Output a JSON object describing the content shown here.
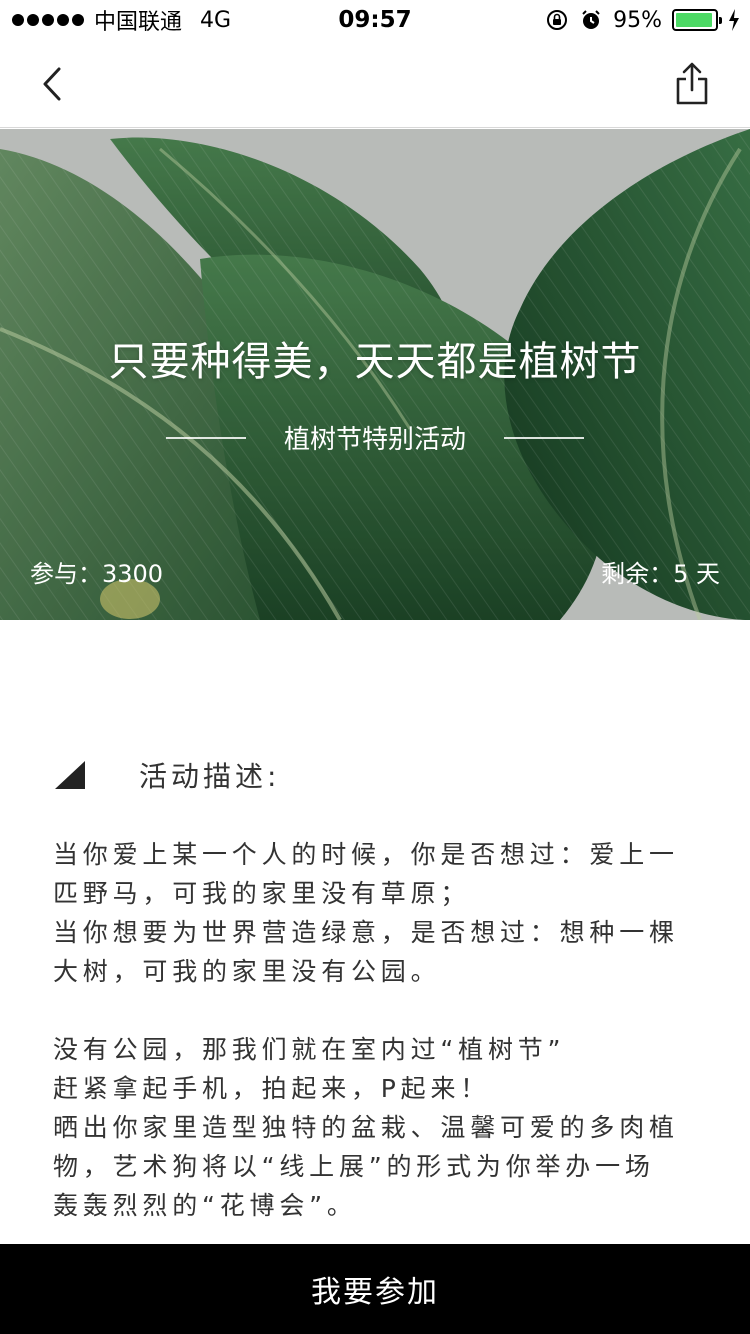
{
  "status_bar": {
    "carrier": "中国联通",
    "network": "4G",
    "time": "09:57",
    "battery_percent": "95%",
    "battery_level": 0.95,
    "battery_color": "#4cd964"
  },
  "nav": {
    "back_icon": "chevron-left-icon",
    "share_icon": "share-icon"
  },
  "hero": {
    "title": "只要种得美，天天都是植树节",
    "subtitle": "植树节特别活动",
    "participants_label": "参与：3300",
    "remaining_label": "剩余：5 天"
  },
  "description": {
    "heading": "活动描述:",
    "paragraphs": [
      [
        "当你爱上某一个人的时候，你是否想过：爱上一",
        "匹野马，可我的家里没有草原；",
        "当你想要为世界营造绿意，是否想过：想种一棵",
        "大树，可我的家里没有公园。"
      ],
      [
        "没有公园，那我们就在室内过“植树节”",
        "赶紧拿起手机，拍起来，P起来！",
        "晒出你家里造型独特的盆栽、温馨可爱的多肉植",
        "物，艺术狗将以“线上展”的形式为你举办一场",
        "轰轰烈烈的“花博会”。"
      ]
    ]
  },
  "cta": {
    "label": "我要参加"
  }
}
